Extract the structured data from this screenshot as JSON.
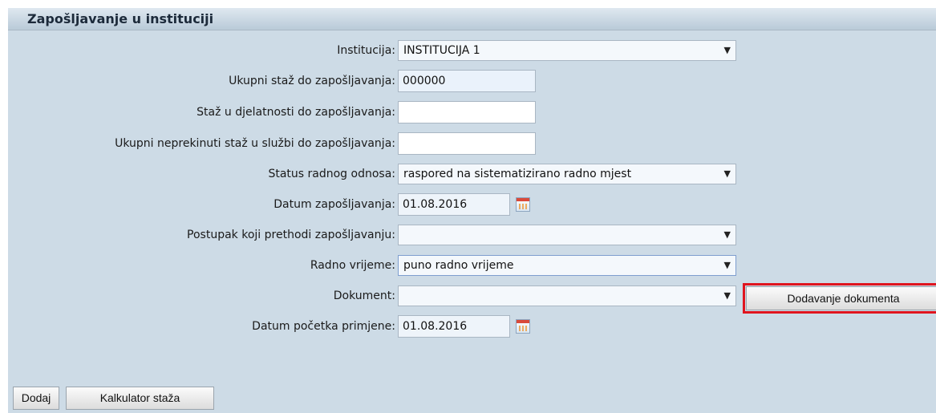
{
  "header": {
    "title": "Zapošljavanje u instituciji"
  },
  "fields": {
    "institucija": {
      "label": "Institucija:",
      "value": "INSTITUCIJA 1"
    },
    "ukupni_staz": {
      "label": "Ukupni staž do zapošljavanja:",
      "value": "000000"
    },
    "staz_djelatnost": {
      "label": "Staž u djelatnosti do zapošljavanja:",
      "value": ""
    },
    "neprekinuti_staz": {
      "label": "Ukupni neprekinuti staž u službi do zapošljavanja:",
      "value": ""
    },
    "status": {
      "label": "Status radnog odnosa:",
      "value": "raspored na sistematizirano radno mjest"
    },
    "datum_zaposljavanja": {
      "label": "Datum zapošljavanja:",
      "value": "01.08.2016"
    },
    "postupak": {
      "label": "Postupak koji prethodi zapošljavanju:",
      "value": ""
    },
    "radno_vrijeme": {
      "label": "Radno vrijeme:",
      "value": "puno radno vrijeme"
    },
    "dokument": {
      "label": "Dokument:",
      "value": ""
    },
    "datum_pocetka": {
      "label": "Datum početka primjene:",
      "value": "01.08.2016"
    }
  },
  "buttons": {
    "dodavanje_dokumenta": "Dodavanje dokumenta",
    "dodaj": "Dodaj",
    "kalkulator": "Kalkulator staža"
  },
  "icons": {
    "dropdown_arrow": "▼",
    "calendar": "calendar-icon"
  },
  "colors": {
    "panel_bg": "#cddbe6",
    "highlight_border": "#e0151f"
  }
}
